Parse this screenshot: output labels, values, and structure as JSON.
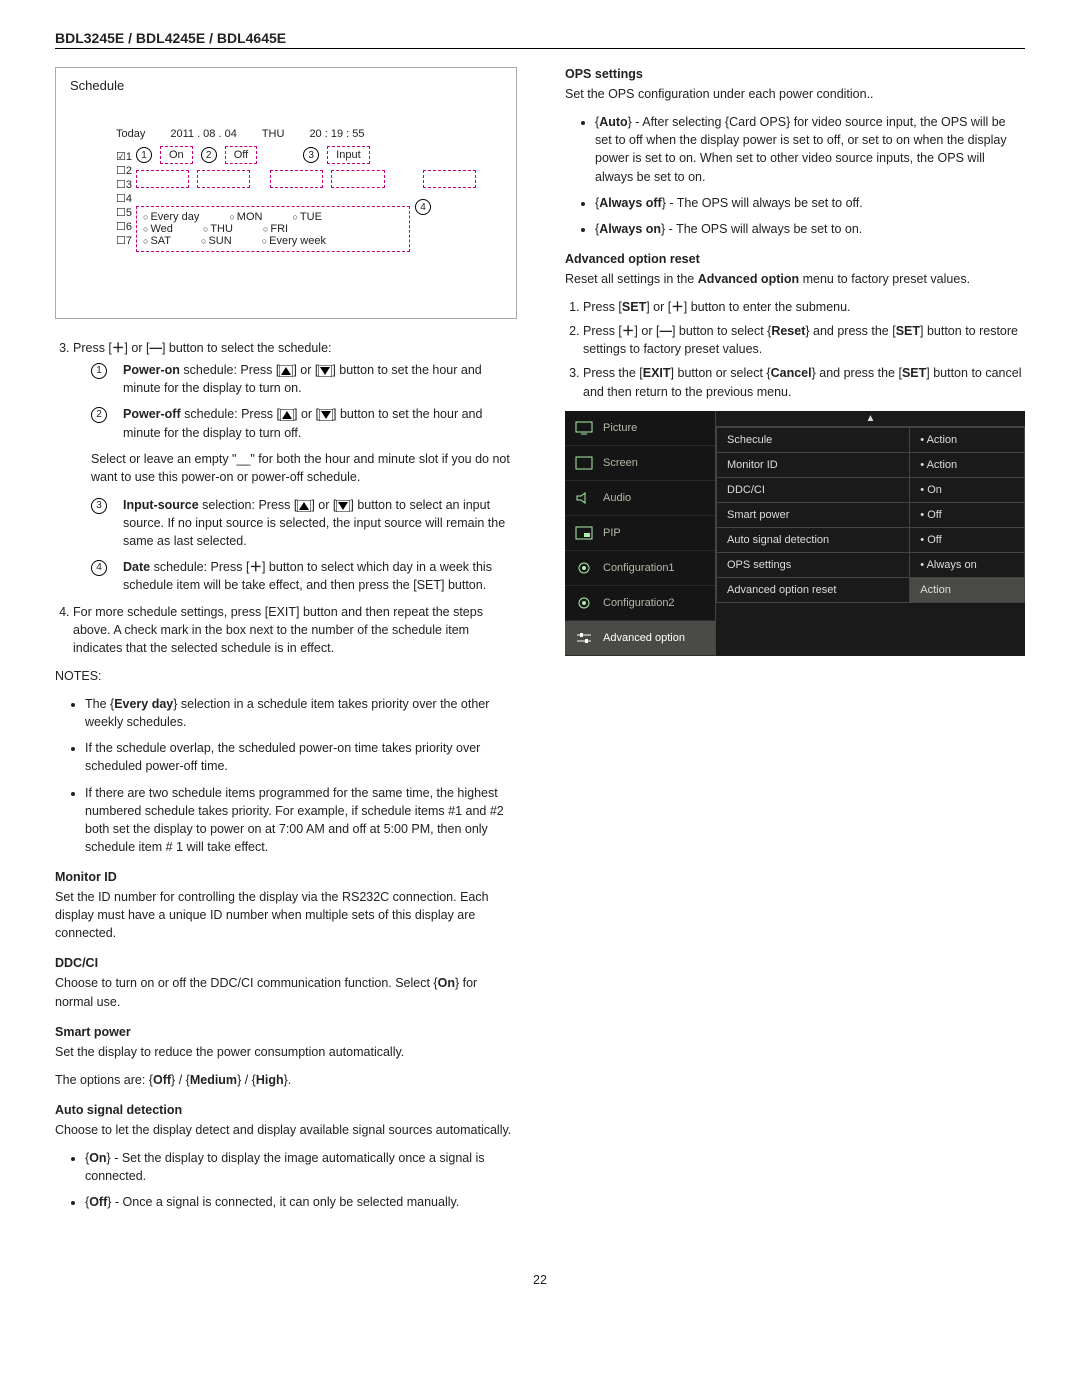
{
  "header": {
    "title": "BDL3245E / BDL4245E / BDL4645E"
  },
  "page_number": "22",
  "schedule_osd": {
    "title": "Schedule",
    "today_label": "Today",
    "date": "2011 . 08 . 04",
    "dow": "THU",
    "time": "20 : 19 : 55",
    "on_label": "On",
    "off_label": "Off",
    "input_label": "Input",
    "rows": [
      "1",
      "2",
      "3",
      "4",
      "5",
      "6",
      "7"
    ],
    "days_row1": [
      "Every day",
      "MON",
      "TUE"
    ],
    "days_row2": [
      "Wed",
      "THU",
      "FRI"
    ],
    "days_row3": [
      "SAT",
      "SUN",
      "Every week"
    ]
  },
  "left": {
    "step3_intro": "Press [",
    "step3_mid": "] or [",
    "step3_end": "] button to select the schedule:",
    "sub1_label": "Power-on",
    "sub1_text": " schedule: Press [",
    "sub1_mid": "] or [",
    "sub1_end": "] button to set the hour and minute for the display to turn on.",
    "sub2_label": "Power-off",
    "sub2_text": " schedule: Press [",
    "sub2_mid": "] or [",
    "sub2_end": "] button to set the hour and minute for the display to turn off.",
    "select_leave": "Select or leave an empty \"__\" for both the hour and minute slot if you do not want to use this power-on or power-off schedule.",
    "sub3_label": "Input-source",
    "sub3_text": " selection: Press [",
    "sub3_mid": "] or [",
    "sub3_end": "] button to select an input source. If no input source is selected, the input source will remain the same as last selected.",
    "sub4_label": "Date",
    "sub4_text": " schedule: Press [",
    "sub4_end": "]  button to select which day in a week this schedule item will be take effect, and then press the [SET] button.",
    "step4": "For more schedule settings, press [EXIT] button and then repeat the steps above. A check mark in the box next to the number of the schedule item indicates that the selected schedule is in effect.",
    "notes_label": "NOTES:",
    "note1_a": "The {",
    "note1_b_bold": "Every day",
    "note1_c": "} selection in a schedule item takes priority over the other weekly schedules.",
    "note2": "If the schedule overlap, the scheduled power-on time takes priority over scheduled power-off time.",
    "note3": "If there are two schedule items programmed for the same time, the highest numbered schedule takes priority. For example, if schedule items #1 and #2 both set the display to power on at 7:00 AM and off at 5:00 PM, then only schedule item # 1 will take effect.",
    "sec_monitorid": "Monitor ID",
    "monitorid_text": "Set the ID number for controlling the display via the RS232C connection. Each display must have a unique ID number when multiple sets of this display are connected.",
    "sec_ddcci": "DDC/CI",
    "ddcci_text_a": "Choose to turn on or off the DDC/CI communication function. Select {",
    "ddcci_text_b_bold": "On",
    "ddcci_text_c": "} for normal use.",
    "sec_smart": "Smart power",
    "smart_text1": "Set the display to reduce the power consumption automatically.",
    "smart_text2_a": "The options are: {",
    "smart_off": "Off",
    "smart_sep": "} / {",
    "smart_med": "Medium",
    "smart_high": "High",
    "smart_text2_end": "}.",
    "sec_auto": "Auto signal detection",
    "auto_text": "Choose to let the display detect and display available signal sources automatically.",
    "auto_on_a": "{",
    "auto_on_bold": "On",
    "auto_on_b": "} - Set the display to display the image automatically once a signal is connected.",
    "auto_off_a": "{",
    "auto_off_bold": "Off",
    "auto_off_b": "} - Once a signal is connected, it can only be selected manually."
  },
  "right": {
    "sec_ops": "OPS settings",
    "ops_text": "Set the OPS configuration under each power condition..",
    "ops_auto_a": "{",
    "ops_auto_bold": "Auto",
    "ops_auto_b": "} - After selecting {Card OPS} for video source input, the OPS will be set to off when the display power is set to off, or set to on when the display power is set to on. When set to other video source inputs, the OPS will always be set to on.",
    "ops_off_a": "{",
    "ops_off_bold": "Always off",
    "ops_off_b": "} - The OPS will always be set to off.",
    "ops_on_a": "{",
    "ops_on_bold": "Always on",
    "ops_on_b": "} - The OPS will always be set to on.",
    "sec_advreset": "Advanced option reset",
    "advreset_text_a": "Reset all settings in the ",
    "advreset_text_bold": "Advanced option",
    "advreset_text_b": " menu to factory preset values.",
    "advreset_1_a": "Press [",
    "advreset_1_bold": "SET",
    "advreset_1_b": "] or [",
    "advreset_1_c": "] button to enter the submenu.",
    "advreset_2_a": "Press [",
    "advreset_2_b": "] or [",
    "advreset_2_c": "] button to select {",
    "advreset_2_bold": "Reset",
    "advreset_2_d": "} and press the [",
    "advreset_2_bold2": "SET",
    "advreset_2_e": "] button to restore settings to factory preset values.",
    "advreset_3_a": "Press the [",
    "advreset_3_bold": "EXIT",
    "advreset_3_b": "] button or select {",
    "advreset_3_bold2": "Cancel",
    "advreset_3_c": "} and press the [",
    "advreset_3_bold3": "SET",
    "advreset_3_d": "] button to cancel and then return to the previous menu.",
    "osd": {
      "nav": [
        "Picture",
        "Screen",
        "Audio",
        "PIP",
        "Configuration1",
        "Configuration2",
        "Advanced option"
      ],
      "rows": [
        {
          "k": "Schecule",
          "v": "Action"
        },
        {
          "k": "Monitor ID",
          "v": "Action"
        },
        {
          "k": "DDC/CI",
          "v": "On"
        },
        {
          "k": "Smart power",
          "v": "Off"
        },
        {
          "k": "Auto signal detection",
          "v": "Off"
        },
        {
          "k": "OPS settings",
          "v": "Always on"
        },
        {
          "k": "Advanced option reset",
          "v": "Action"
        }
      ]
    }
  }
}
